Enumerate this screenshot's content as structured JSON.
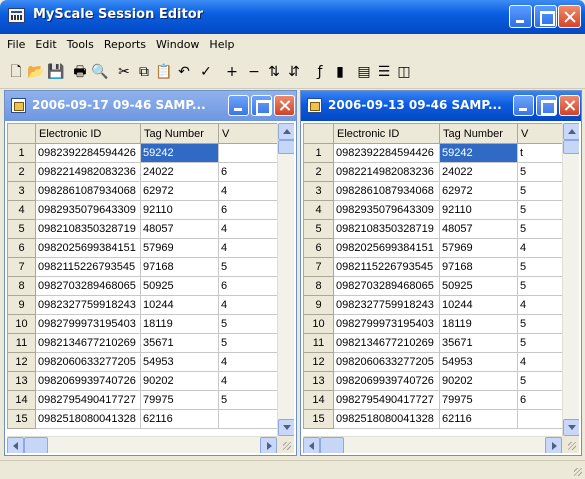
{
  "window": {
    "title": "MyScale Session Editor"
  },
  "menu": [
    "File",
    "Edit",
    "Tools",
    "Reports",
    "Window",
    "Help"
  ],
  "toolbar": [
    {
      "name": "new-file-icon",
      "glyph": "🗋"
    },
    {
      "name": "open-folder-icon",
      "glyph": "📂"
    },
    {
      "name": "save-icon",
      "glyph": "💾"
    },
    {
      "name": "print-icon",
      "glyph": "🖶"
    },
    {
      "name": "find-icon",
      "glyph": "🔍"
    },
    {
      "name": "cut-icon",
      "glyph": "✂"
    },
    {
      "name": "copy-icon",
      "glyph": "⧉"
    },
    {
      "name": "paste-icon",
      "glyph": "📋"
    },
    {
      "name": "undo-icon",
      "glyph": "↶"
    },
    {
      "name": "check-icon",
      "glyph": "✓"
    },
    {
      "name": "add-row-icon",
      "glyph": "+"
    },
    {
      "name": "remove-row-icon",
      "glyph": "−"
    },
    {
      "name": "sort-ascending-icon",
      "glyph": "⇅"
    },
    {
      "name": "sort-descending-icon",
      "glyph": "⇵"
    },
    {
      "name": "formula-icon",
      "glyph": "ƒ"
    },
    {
      "name": "chart-icon",
      "glyph": "▮"
    },
    {
      "name": "tile-windows-icon",
      "glyph": "▤"
    },
    {
      "name": "tile-horizontal-icon",
      "glyph": "☰"
    },
    {
      "name": "tile-vertical-icon",
      "glyph": "◫"
    }
  ],
  "windows": [
    {
      "title": "2006-09-17 09-46 SAMP...",
      "active": false,
      "col_e": "Electronic ID",
      "col_t": "Tag Number",
      "col_v": "V",
      "rows": [
        {
          "n": "1",
          "eid": "0982392284594426",
          "tag": "59242",
          "v": ""
        },
        {
          "n": "2",
          "eid": "0982214982083236",
          "tag": "24022",
          "v": "6"
        },
        {
          "n": "3",
          "eid": "0982861087934068",
          "tag": "62972",
          "v": "4"
        },
        {
          "n": "4",
          "eid": "0982935079643309",
          "tag": "92110",
          "v": "6"
        },
        {
          "n": "5",
          "eid": "0982108350328719",
          "tag": "48057",
          "v": "4"
        },
        {
          "n": "6",
          "eid": "0982025699384151",
          "tag": "57969",
          "v": "4"
        },
        {
          "n": "7",
          "eid": "0982115226793545",
          "tag": "97168",
          "v": "5"
        },
        {
          "n": "8",
          "eid": "0982703289468065",
          "tag": "50925",
          "v": "6"
        },
        {
          "n": "9",
          "eid": "0982327759918243",
          "tag": "10244",
          "v": "4"
        },
        {
          "n": "10",
          "eid": "0982799973195403",
          "tag": "18119",
          "v": "5"
        },
        {
          "n": "11",
          "eid": "0982134677210269",
          "tag": "35671",
          "v": "5"
        },
        {
          "n": "12",
          "eid": "0982060633277205",
          "tag": "54953",
          "v": "4"
        },
        {
          "n": "13",
          "eid": "0982069939740726",
          "tag": "90202",
          "v": "4"
        },
        {
          "n": "14",
          "eid": "0982795490417727",
          "tag": "79975",
          "v": "5"
        },
        {
          "n": "15",
          "eid": "0982518080041328",
          "tag": "62116",
          "v": ""
        }
      ]
    },
    {
      "title": "2006-09-13 09-46 SAMP...",
      "active": true,
      "col_e": "Electronic ID",
      "col_t": "Tag Number",
      "col_v": "V",
      "rows": [
        {
          "n": "1",
          "eid": "0982392284594426",
          "tag": "59242",
          "v": "t"
        },
        {
          "n": "2",
          "eid": "0982214982083236",
          "tag": "24022",
          "v": "5"
        },
        {
          "n": "3",
          "eid": "0982861087934068",
          "tag": "62972",
          "v": "5"
        },
        {
          "n": "4",
          "eid": "0982935079643309",
          "tag": "92110",
          "v": "5"
        },
        {
          "n": "5",
          "eid": "0982108350328719",
          "tag": "48057",
          "v": "5"
        },
        {
          "n": "6",
          "eid": "0982025699384151",
          "tag": "57969",
          "v": "4"
        },
        {
          "n": "7",
          "eid": "0982115226793545",
          "tag": "97168",
          "v": "5"
        },
        {
          "n": "8",
          "eid": "0982703289468065",
          "tag": "50925",
          "v": "5"
        },
        {
          "n": "9",
          "eid": "0982327759918243",
          "tag": "10244",
          "v": "4"
        },
        {
          "n": "10",
          "eid": "0982799973195403",
          "tag": "18119",
          "v": "5"
        },
        {
          "n": "11",
          "eid": "0982134677210269",
          "tag": "35671",
          "v": "5"
        },
        {
          "n": "12",
          "eid": "0982060633277205",
          "tag": "54953",
          "v": "4"
        },
        {
          "n": "13",
          "eid": "0982069939740726",
          "tag": "90202",
          "v": "5"
        },
        {
          "n": "14",
          "eid": "0982795490417727",
          "tag": "79975",
          "v": "6"
        },
        {
          "n": "15",
          "eid": "0982518080041328",
          "tag": "62116",
          "v": ""
        }
      ]
    }
  ],
  "selected_row": "1"
}
